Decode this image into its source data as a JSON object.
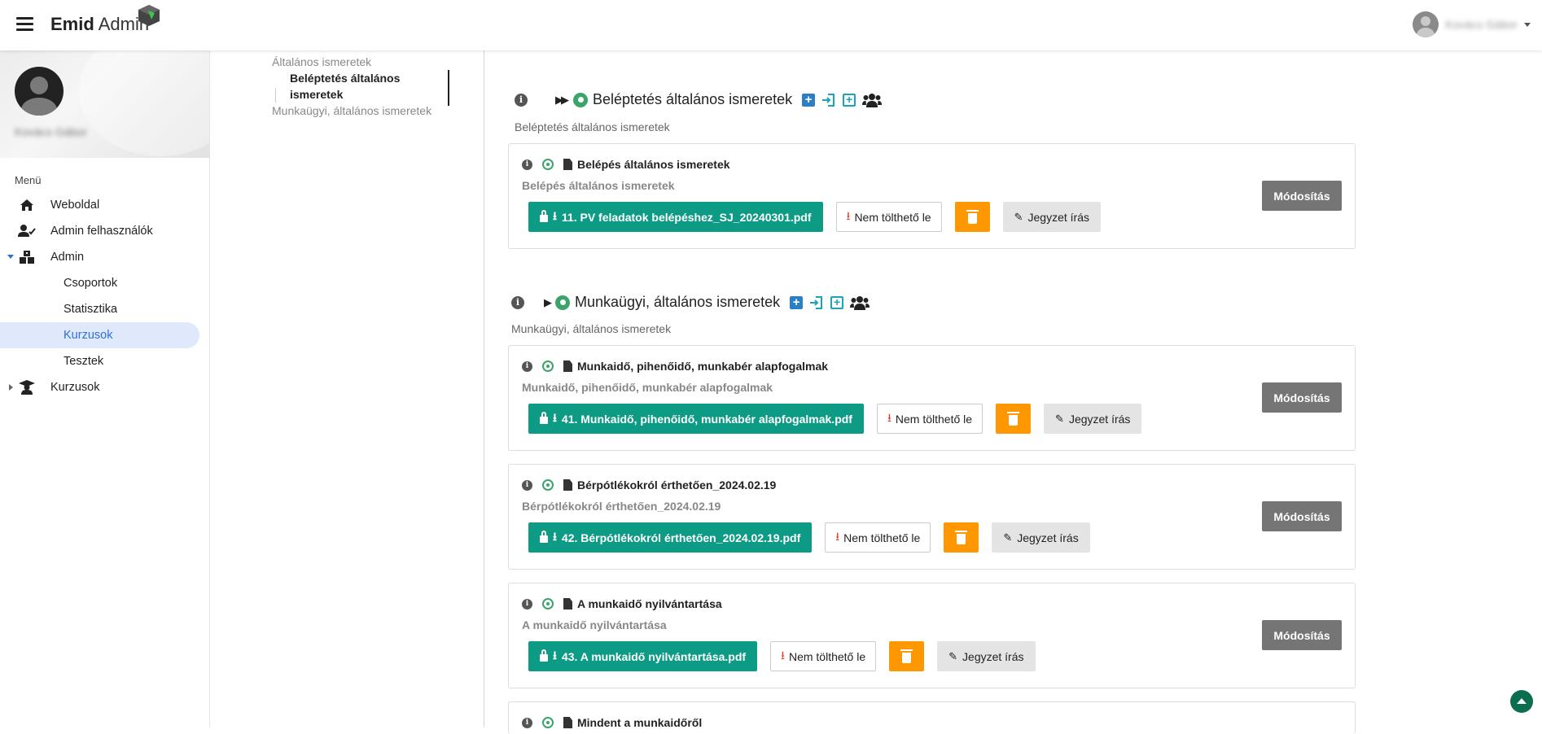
{
  "header": {
    "brand_bold": "Emid",
    "brand_light": "Admin",
    "user_name": "Kovács Gábor"
  },
  "sidebar": {
    "profile_name": "Kovács Gábor",
    "menu_label": "Menü",
    "items": [
      {
        "label": "Weboldal",
        "icon": "home-icon"
      },
      {
        "label": "Admin felhasználók",
        "icon": "user-check-icon"
      },
      {
        "label": "Admin",
        "icon": "boxes-icon"
      },
      {
        "label": "Csoportok"
      },
      {
        "label": "Statisztika"
      },
      {
        "label": "Kurzusok"
      },
      {
        "label": "Tesztek"
      },
      {
        "label": "Kurzusok",
        "icon": "graduate-icon"
      }
    ]
  },
  "toc": {
    "item1": "Általános ismeretek",
    "sub1": "Beléptetés általános ismeretek",
    "item2": "Munkaügyi, általános ismeretek"
  },
  "sections": [
    {
      "title": "Beléptetés általános ismeretek",
      "desc": "Beléptetés általános ismeretek",
      "cards": [
        {
          "title": "Belépés általános ismeretek",
          "sub": "Belépés általános ismeretek",
          "file": "11. PV feladatok belépéshez_SJ_20240301.pdf"
        }
      ]
    },
    {
      "title": "Munkaügyi, általános ismeretek",
      "desc": "Munkaügyi, általános ismeretek",
      "cards": [
        {
          "title": "Munkaidő, pihenőidő, munkabér alapfogalmak",
          "sub": "Munkaidő, pihenőidő, munkabér alapfogalmak",
          "file": "41. Munkaidő, pihenőidő, munkabér alapfogalmak.pdf"
        },
        {
          "title": "Bérpótlékokról érthetően_2024.02.19",
          "sub": "Bérpótlékokról érthetően_2024.02.19",
          "file": "42. Bérpótlékokról érthetően_2024.02.19.pdf"
        },
        {
          "title": "A munkaidő nyilvántartása",
          "sub": "A munkaidő nyilvántartása",
          "file": "43. A munkaidő nyilvántartása.pdf"
        },
        {
          "title": "Mindent a munkaidőről"
        }
      ]
    }
  ],
  "buttons": {
    "no_download": "Nem tölthető le",
    "note": "Jegyzet írás",
    "modify": "Módosítás"
  }
}
